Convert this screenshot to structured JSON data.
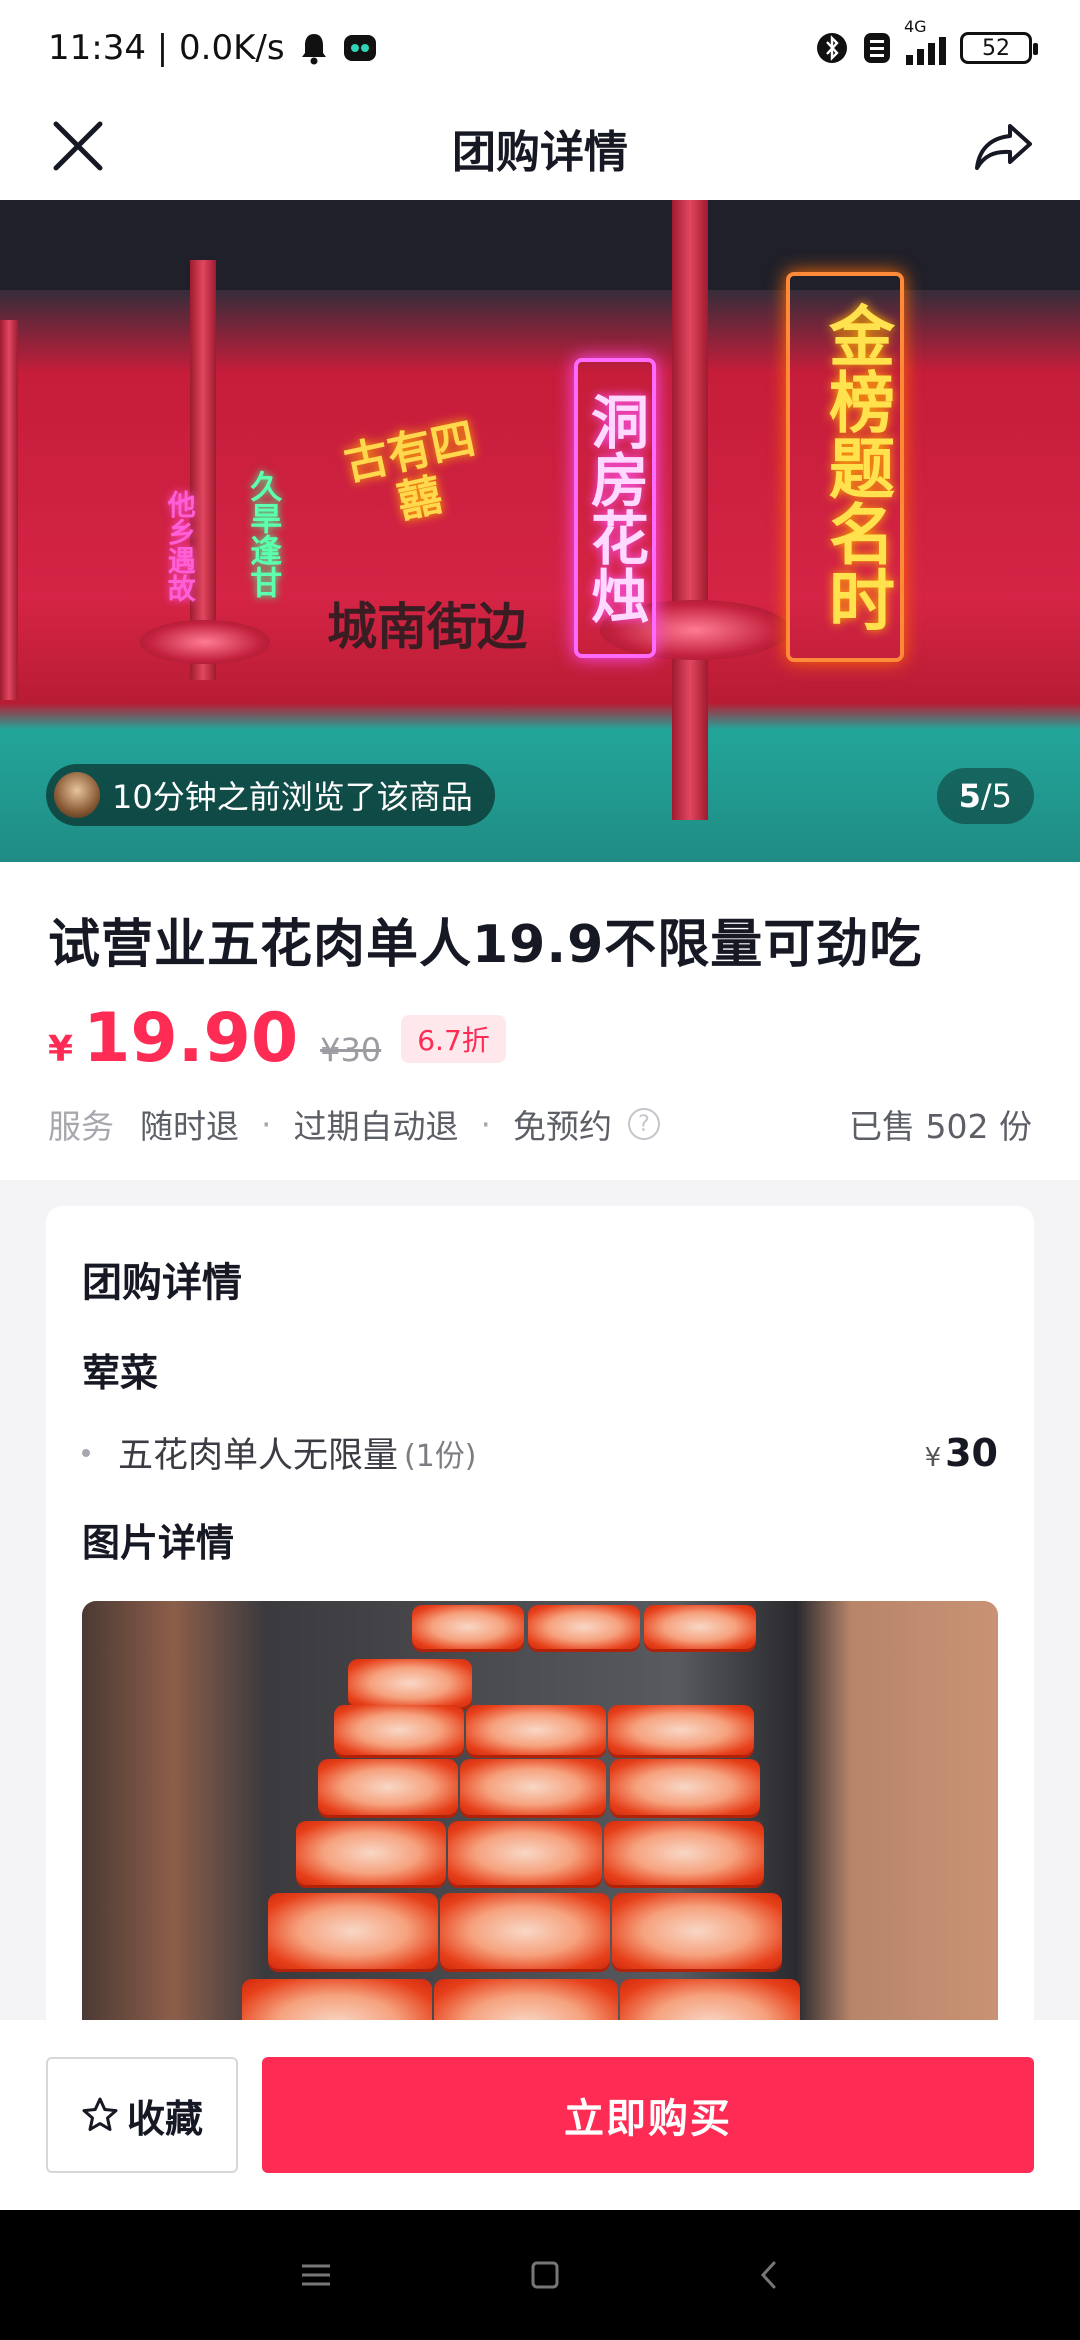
{
  "status_bar": {
    "time": "11:34 | 0.0K/s",
    "network": "4G",
    "battery": "52"
  },
  "navbar": {
    "title": "团购详情"
  },
  "hero": {
    "browse_text": "10分钟之前浏览了该商品",
    "counter_current": "5",
    "counter_total": "/5",
    "signs": [
      "他乡遇故",
      "久旱逢甘",
      "古有四囍",
      "城南街边",
      "洞房花烛",
      "金榜题名时"
    ]
  },
  "product": {
    "title": "试营业五花肉单人19.9不限量可劲吃",
    "currency": "¥",
    "price": "19.90",
    "original_price": "¥30",
    "discount": "6.7折",
    "service_label": "服务",
    "services": [
      "随时退",
      "过期自动退",
      "免预约"
    ],
    "sold": "已售 502 份"
  },
  "details": {
    "section_title": "团购详情",
    "category": "荤菜",
    "items": [
      {
        "name": "五花肉单人无限量",
        "qty": "(1份)",
        "currency": "¥",
        "price": "30"
      }
    ],
    "images_title": "图片详情"
  },
  "actions": {
    "favorite": "收藏",
    "buy": "立即购买"
  },
  "colors": {
    "accent": "#fe2c55",
    "discount_bg": "#ffe8ec"
  }
}
